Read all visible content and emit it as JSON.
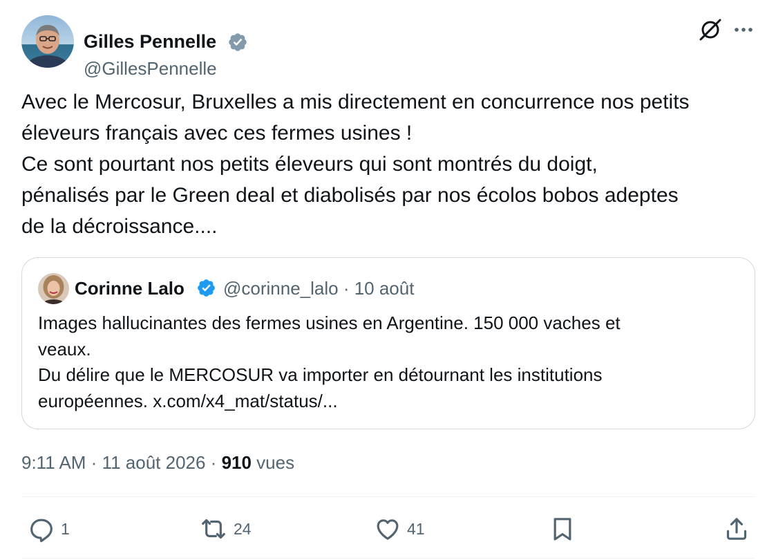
{
  "author": {
    "name": "Gilles Pennelle",
    "handle": "@GillesPennelle",
    "avatar_icon": "profile-photo",
    "verified_color": "#829aab"
  },
  "tweet": {
    "lines": [
      "Avec le Mercosur, Bruxelles a mis directement en concurrence nos petits",
      "éleveurs français avec ces fermes usines !",
      "Ce sont pourtant nos petits éleveurs qui sont montrés du doigt,",
      "pénalisés par le Green deal et diabolisés par nos écolos bobos adeptes",
      "de la décroissance...."
    ]
  },
  "quote": {
    "name": "Corinne Lalo",
    "handle_date": "@corinne_lalo · 10 août",
    "verified_color": "#1d9bf0",
    "lines": [
      "Images hallucinantes des fermes usines en Argentine.  150 000 vaches et",
      "veaux.",
      "Du délire que le MERCOSUR va importer en détournant les institutions",
      "européennes. x.com/x4_mat/status/..."
    ]
  },
  "meta": {
    "time_date": "9:11 AM · 11 août 2026 · ",
    "views_count": "910",
    "views_label": " vues"
  },
  "actions": {
    "replies": "1",
    "reposts": "24",
    "likes": "41"
  },
  "icons": {
    "grok": "grok-icon",
    "more": "more-icon",
    "reply": "reply-icon",
    "repost": "repost-icon",
    "like": "heart-icon",
    "bookmark": "bookmark-icon",
    "share": "share-icon"
  },
  "colors": {
    "text": "#0f1419",
    "secondary": "#536471",
    "border": "#cfd9de"
  }
}
